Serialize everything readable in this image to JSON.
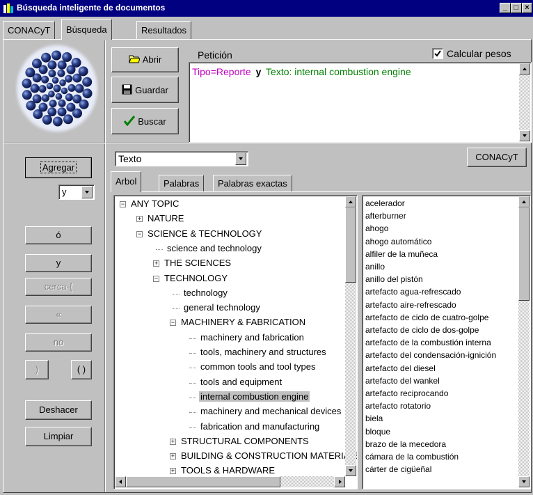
{
  "window": {
    "title": "Búsqueda inteligente de documentos"
  },
  "tabs": [
    {
      "label": "CONACyT"
    },
    {
      "label": "Búsqueda"
    },
    {
      "label": "Resultados"
    }
  ],
  "buttons": {
    "abrir": "Abrir",
    "guardar": "Guardar",
    "buscar": "Buscar",
    "conacyt": "CONACyT",
    "agregar": "Agregar",
    "o": "ó",
    "y": "y",
    "cerca": "cerca-{",
    "star": "«",
    "no": "no",
    "paren_close": ")",
    "parens": "( )",
    "deshacer": "Deshacer",
    "limpiar": "Limpiar"
  },
  "peticion": {
    "label": "Petición",
    "checkbox_label": "Calcular pesos",
    "checked": true,
    "query": {
      "part1": "Tipo=Reporte",
      "op": "y",
      "part2": "Texto: internal combustion engine"
    }
  },
  "operator_select": {
    "value": "y"
  },
  "field_select": {
    "value": "Texto"
  },
  "inner_tabs": [
    {
      "label": "Arbol"
    },
    {
      "label": "Palabras"
    },
    {
      "label": "Palabras exactas"
    }
  ],
  "tree": [
    {
      "label": "ANY TOPIC",
      "toggle": "−"
    },
    {
      "label": "NATURE",
      "toggle": "+"
    },
    {
      "label": "SCIENCE & TECHNOLOGY",
      "toggle": "−"
    },
    {
      "label": "science and technology",
      "toggle": ""
    },
    {
      "label": "THE SCIENCES",
      "toggle": "+"
    },
    {
      "label": "TECHNOLOGY",
      "toggle": "−"
    },
    {
      "label": "technology",
      "toggle": ""
    },
    {
      "label": "general technology",
      "toggle": ""
    },
    {
      "label": "MACHINERY & FABRICATION",
      "toggle": "−"
    },
    {
      "label": "machinery and fabrication",
      "toggle": ""
    },
    {
      "label": "tools, machinery and structures",
      "toggle": ""
    },
    {
      "label": "common tools and tool types",
      "toggle": ""
    },
    {
      "label": "tools and equipment",
      "toggle": ""
    },
    {
      "label": "internal combustion engine",
      "toggle": "",
      "selected": true
    },
    {
      "label": "machinery and mechanical devices",
      "toggle": ""
    },
    {
      "label": "fabrication and manufacturing",
      "toggle": ""
    },
    {
      "label": "STRUCTURAL COMPONENTS",
      "toggle": "+"
    },
    {
      "label": "BUILDING & CONSTRUCTION MATERIALS",
      "toggle": "+"
    },
    {
      "label": "TOOLS & HARDWARE",
      "toggle": "+"
    }
  ],
  "words": [
    "acelerador",
    "afterburner",
    "ahogo",
    "ahogo automático",
    "alfiler de la muñeca",
    "anillo",
    "anillo del pistón",
    "artefacto agua-refrescado",
    "artefacto aire-refrescado",
    "artefacto de ciclo de cuatro-golpe",
    "artefacto de ciclo de dos-golpe",
    "artefacto de la combustión interna",
    "artefacto del condensación-ignición",
    "artefacto del diesel",
    "artefacto del wankel",
    "artefacto reciprocando",
    "artefacto rotatorio",
    "biela",
    "bloque",
    "brazo de la mecedora",
    "cámara de la combustión",
    "cárter de cigüeñal"
  ],
  "colors": {
    "titlebar": "#000080",
    "query_part1": "#c000c0",
    "query_part2": "#008000",
    "selection": "#c0c0c0"
  }
}
